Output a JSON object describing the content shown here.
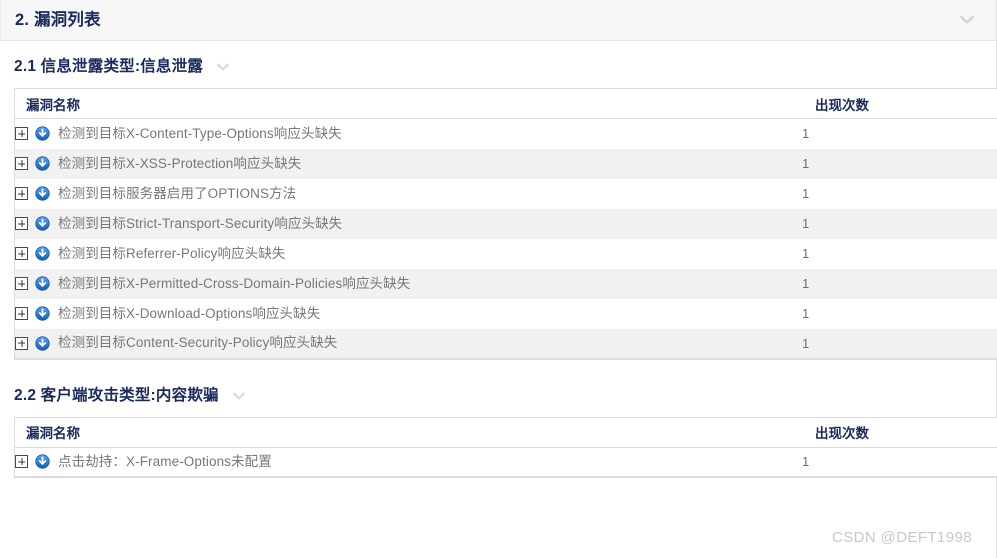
{
  "section": {
    "title": "2. 漏洞列表",
    "collapse_icon": "chevron-down-icon"
  },
  "subsections": [
    {
      "title": "2.1 信息泄露类型:信息泄露",
      "collapse_icon": "chevron-down-icon",
      "table": {
        "headers": {
          "name": "漏洞名称",
          "count": "出现次数"
        },
        "rows": [
          {
            "expander": "+",
            "severity_icon": "blue-down-arrow-icon",
            "name": "检测到目标X-Content-Type-Options响应头缺失",
            "count": "1"
          },
          {
            "expander": "+",
            "severity_icon": "blue-down-arrow-icon",
            "name": "检测到目标X-XSS-Protection响应头缺失",
            "count": "1"
          },
          {
            "expander": "+",
            "severity_icon": "blue-down-arrow-icon",
            "name": "检测到目标服务器启用了OPTIONS方法",
            "count": "1"
          },
          {
            "expander": "+",
            "severity_icon": "blue-down-arrow-icon",
            "name": "检测到目标Strict-Transport-Security响应头缺失",
            "count": "1"
          },
          {
            "expander": "+",
            "severity_icon": "blue-down-arrow-icon",
            "name": "检测到目标Referrer-Policy响应头缺失",
            "count": "1"
          },
          {
            "expander": "+",
            "severity_icon": "blue-down-arrow-icon",
            "name": "检测到目标X-Permitted-Cross-Domain-Policies响应头缺失",
            "count": "1"
          },
          {
            "expander": "+",
            "severity_icon": "blue-down-arrow-icon",
            "name": "检测到目标X-Download-Options响应头缺失",
            "count": "1"
          },
          {
            "expander": "+",
            "severity_icon": "blue-down-arrow-icon",
            "name": "检测到目标Content-Security-Policy响应头缺失",
            "count": "1"
          }
        ]
      }
    },
    {
      "title": "2.2 客户端攻击类型:内容欺骗",
      "collapse_icon": "chevron-down-icon",
      "table": {
        "headers": {
          "name": "漏洞名称",
          "count": "出现次数"
        },
        "rows": [
          {
            "expander": "+",
            "severity_icon": "blue-down-arrow-icon",
            "name": "点击劫持：X-Frame-Options未配置",
            "count": "1"
          }
        ]
      }
    }
  ],
  "watermark": "CSDN @DEFT1998",
  "colors": {
    "heading": "#1b2a5e",
    "body_text": "#77777b",
    "severity_blue": "#1a6fd4",
    "stripe": "#f1f1f1",
    "border": "#dcdcde",
    "bar_bg": "#f7f7f8",
    "chevron": "#d2d2d6",
    "watermark": "#c8c8cc"
  }
}
